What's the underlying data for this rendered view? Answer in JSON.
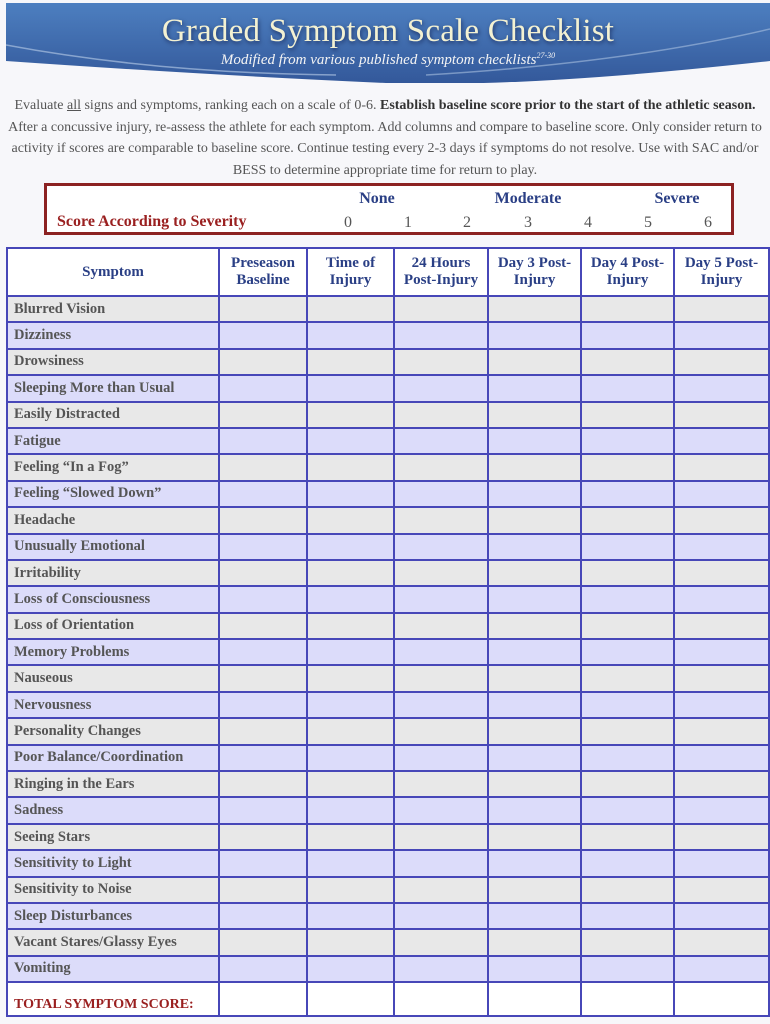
{
  "header": {
    "title": "Graded Symptom Scale Checklist",
    "subtitle": "Modified from various published symptom checklists",
    "subtitle_ref": "27-30",
    "colors": {
      "banner": "#4a78b8",
      "title": "#f3f1d2"
    }
  },
  "instructions": {
    "part1": "Evaluate ",
    "underlined": "all",
    "part2": " signs and symptoms, ranking each on a scale of 0-6. ",
    "bold": "Establish baseline score prior to the start of the athletic season.",
    "part3": " After a concussive injury, re-assess the athlete for each symptom.  Add columns and compare to baseline score.  Only consider return to activity if scores are comparable to baseline score. Continue testing every 2-3 days if symptoms do not resolve. Use with SAC and/or BESS to determine appropriate time for return to play."
  },
  "severity": {
    "label": "Score According to Severity",
    "levels": [
      "None",
      "Moderate",
      "Severe"
    ],
    "scores": [
      "0",
      "1",
      "2",
      "3",
      "4",
      "5",
      "6"
    ],
    "border_color": "#8c2222"
  },
  "table": {
    "columns": [
      "Symptom",
      "Preseason Baseline",
      "Time of Injury",
      "24 Hours Post-Injury",
      "Day 3 Post-Injury",
      "Day 4 Post-Injury",
      "Day 5 Post-Injury"
    ],
    "column_lines": [
      [
        "Symptom"
      ],
      [
        "Preseason",
        "Baseline"
      ],
      [
        "Time of",
        "Injury"
      ],
      [
        "24 Hours",
        "Post-Injury"
      ],
      [
        "Day 3 Post-",
        "Injury"
      ],
      [
        "Day 4 Post-",
        "Injury"
      ],
      [
        "Day 5 Post-",
        "Injury"
      ]
    ],
    "symptoms": [
      "Blurred Vision",
      "Dizziness",
      "Drowsiness",
      "Sleeping More than Usual",
      "Easily Distracted",
      "Fatigue",
      "Feeling “In a Fog”",
      "Feeling “Slowed Down”",
      "Headache",
      "Unusually Emotional",
      "Irritability",
      "Loss of Consciousness",
      "Loss of Orientation",
      "Memory Problems",
      "Nauseous",
      "Nervousness",
      "Personality Changes",
      "Poor Balance/Coordination",
      "Ringing in the Ears",
      "Sadness",
      "Seeing Stars",
      "Sensitivity to Light",
      "Sensitivity to Noise",
      "Sleep Disturbances",
      "Vacant Stares/Glassy Eyes",
      "Vomiting"
    ],
    "total_label": "TOTAL SYMPTOM SCORE:",
    "colors": {
      "grid": "#4747b8",
      "row_gray": "#e8e8e8",
      "row_lavender": "#dcdcfa"
    }
  }
}
